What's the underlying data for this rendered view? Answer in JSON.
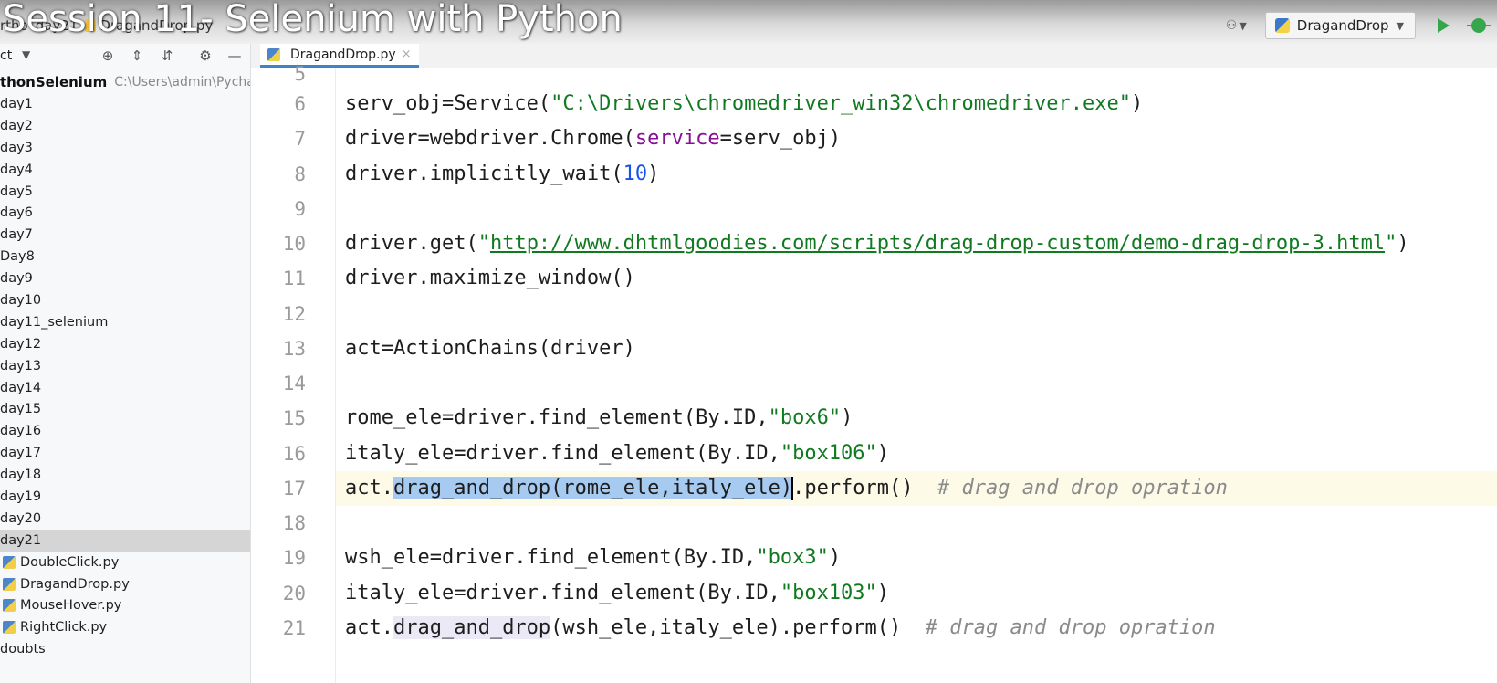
{
  "video_overlay_title": "Session 11- Selenium with Python",
  "navbar": {
    "crumb_1": "rtho",
    "crumb_2": "day21",
    "crumb_3": "DragandDrop.py"
  },
  "run_config": {
    "label": "DragandDrop"
  },
  "project_panel": {
    "toolbar_label": "ct",
    "root_name": "thonSelenium",
    "root_path": "C:\\Users\\admin\\Pycharm",
    "items": [
      {
        "label": "day1",
        "type": "folder"
      },
      {
        "label": "day2",
        "type": "folder"
      },
      {
        "label": "day3",
        "type": "folder"
      },
      {
        "label": "day4",
        "type": "folder"
      },
      {
        "label": "day5",
        "type": "folder"
      },
      {
        "label": "day6",
        "type": "folder"
      },
      {
        "label": "day7",
        "type": "folder"
      },
      {
        "label": "Day8",
        "type": "folder"
      },
      {
        "label": "day9",
        "type": "folder"
      },
      {
        "label": "day10",
        "type": "folder"
      },
      {
        "label": "day11_selenium",
        "type": "folder"
      },
      {
        "label": "day12",
        "type": "folder"
      },
      {
        "label": "day13",
        "type": "folder"
      },
      {
        "label": "day14",
        "type": "folder"
      },
      {
        "label": "day15",
        "type": "folder"
      },
      {
        "label": "day16",
        "type": "folder"
      },
      {
        "label": "day17",
        "type": "folder"
      },
      {
        "label": "day18",
        "type": "folder"
      },
      {
        "label": "day19",
        "type": "folder"
      },
      {
        "label": "day20",
        "type": "folder"
      },
      {
        "label": "day21",
        "type": "folder",
        "selected": true
      },
      {
        "label": "DoubleClick.py",
        "type": "file"
      },
      {
        "label": "DragandDrop.py",
        "type": "file"
      },
      {
        "label": "MouseHover.py",
        "type": "file"
      },
      {
        "label": "RightClick.py",
        "type": "file"
      },
      {
        "label": "doubts",
        "type": "folder"
      }
    ]
  },
  "editor": {
    "tab_label": "DragandDrop.py",
    "tab_close": "×",
    "first_line_number": "5",
    "lines": [
      {
        "num": "6",
        "segments": [
          {
            "t": "serv_obj=Service(",
            "c": ""
          },
          {
            "t": "\"C:\\Drivers\\chromedriver_win32\\chromedriver.exe\"",
            "c": "str"
          },
          {
            "t": ")",
            "c": ""
          }
        ]
      },
      {
        "num": "7",
        "segments": [
          {
            "t": "driver=webdriver.Chrome(",
            "c": ""
          },
          {
            "t": "service",
            "c": "kw"
          },
          {
            "t": "=serv_obj)",
            "c": ""
          }
        ]
      },
      {
        "num": "8",
        "segments": [
          {
            "t": "driver.implicitly_wait(",
            "c": ""
          },
          {
            "t": "10",
            "c": "num"
          },
          {
            "t": ")",
            "c": ""
          }
        ]
      },
      {
        "num": "9",
        "segments": []
      },
      {
        "num": "10",
        "segments": [
          {
            "t": "driver.get(",
            "c": ""
          },
          {
            "t": "\"",
            "c": "str"
          },
          {
            "t": "http://www.dhtmlgoodies.com/scripts/drag-drop-custom/demo-drag-drop-3.html",
            "c": "url"
          },
          {
            "t": "\"",
            "c": "str"
          },
          {
            "t": ")",
            "c": ""
          }
        ]
      },
      {
        "num": "11",
        "segments": [
          {
            "t": "driver.maximize_window()",
            "c": ""
          }
        ]
      },
      {
        "num": "12",
        "segments": []
      },
      {
        "num": "13",
        "segments": [
          {
            "t": "act=ActionChains(driver)",
            "c": ""
          }
        ]
      },
      {
        "num": "14",
        "segments": []
      },
      {
        "num": "15",
        "segments": [
          {
            "t": "rome_ele=driver.find_element(By.ID,",
            "c": ""
          },
          {
            "t": "\"box6\"",
            "c": "str"
          },
          {
            "t": ")",
            "c": ""
          }
        ]
      },
      {
        "num": "16",
        "segments": [
          {
            "t": "italy_ele=driver.find_element(By.ID,",
            "c": ""
          },
          {
            "t": "\"box106\"",
            "c": "str"
          },
          {
            "t": ")",
            "c": ""
          }
        ]
      },
      {
        "num": "17",
        "current": true,
        "segments": [
          {
            "t": "act.",
            "c": ""
          },
          {
            "t": "drag_and_drop(rome_ele,italy_ele)",
            "c": "sel"
          },
          {
            "t": "|",
            "c": "caret"
          },
          {
            "t": ".perform()  ",
            "c": ""
          },
          {
            "t": "# drag and drop opration",
            "c": "cmt"
          }
        ]
      },
      {
        "num": "18",
        "segments": []
      },
      {
        "num": "19",
        "segments": [
          {
            "t": "wsh_ele=driver.find_element(By.ID,",
            "c": ""
          },
          {
            "t": "\"box3\"",
            "c": "str"
          },
          {
            "t": ")",
            "c": ""
          }
        ]
      },
      {
        "num": "20",
        "segments": [
          {
            "t": "italy_ele=driver.find_element(By.ID,",
            "c": ""
          },
          {
            "t": "\"box103\"",
            "c": "str"
          },
          {
            "t": ")",
            "c": ""
          }
        ]
      },
      {
        "num": "21",
        "segments": [
          {
            "t": "act.",
            "c": ""
          },
          {
            "t": "drag_and_drop",
            "c": "hl"
          },
          {
            "t": "(wsh_ele,italy_ele).perform()  ",
            "c": ""
          },
          {
            "t": "# drag and drop opration",
            "c": "cmt"
          }
        ]
      }
    ]
  },
  "colors": {
    "string": "#117a21",
    "number": "#1750eb",
    "keyword": "#871094",
    "comment": "#8a8a8a",
    "selection": "#a6caf0",
    "run_green": "#35a64b"
  }
}
